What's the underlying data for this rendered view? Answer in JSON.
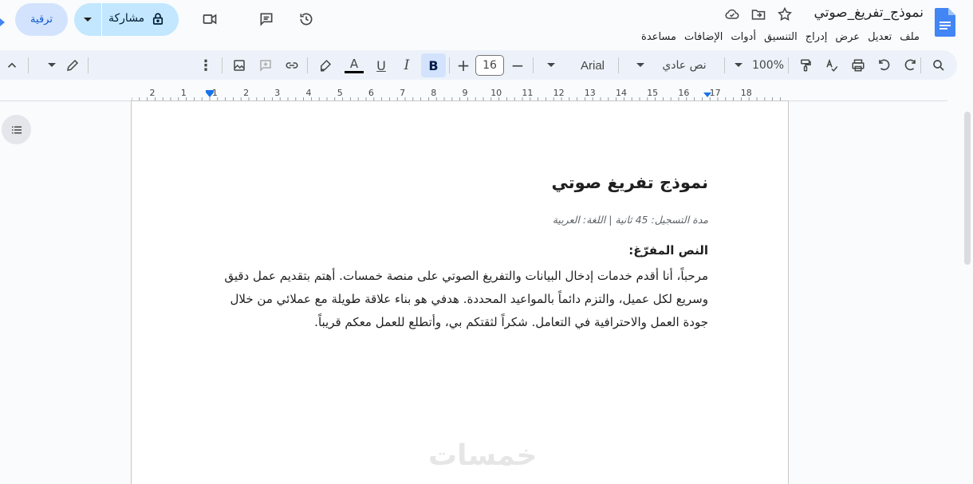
{
  "header": {
    "title": "نموذج_تفريغ_صوتي",
    "share_label": "مشاركة",
    "upgrade_label": "ترقية"
  },
  "menu": [
    "ملف",
    "تعديل",
    "عرض",
    "إدراج",
    "التنسيق",
    "أدوات",
    "الإضافات",
    "مساعدة"
  ],
  "toolbar": {
    "zoom": "100%",
    "style": "نص عادي",
    "font": "Arial",
    "font_size": "16",
    "bold_label": "B",
    "italic_label": "I",
    "underline_label": "U",
    "textcolor_label": "A"
  },
  "ruler": {
    "labels": [
      "2",
      "1",
      "1",
      "2",
      "3",
      "4",
      "5",
      "6",
      "7",
      "8",
      "9",
      "10",
      "11",
      "12",
      "13",
      "14",
      "15",
      "16",
      "17",
      "18"
    ]
  },
  "document": {
    "heading": "نموذج تفريغ صوتي",
    "meta": "مدة التسجيل: 45 ثانية  |  اللغة: العربية",
    "label": ":النص المفرّغ",
    "body": "مرحباً، أنا أقدم خدمات إدخال البيانات والتفريغ الصوتي على منصة خمسات. أهتم بتقديم عمل دقيق وسريع لكل عميل، والتزم دائماً بالمواعيد المحددة. هدفي هو بناء علاقة طويلة مع عملائي من خلال جودة العمل والاحترافية في التعامل. شكراً لثقتكم بي، وأتطلع للعمل معكم قريباً."
  },
  "watermark": "خمسات",
  "colors": {
    "accent": "#0b57d0",
    "share_bg": "#c2e7ff",
    "toolbar_bg": "#edf2fa",
    "docs_blue": "#4285f4"
  }
}
